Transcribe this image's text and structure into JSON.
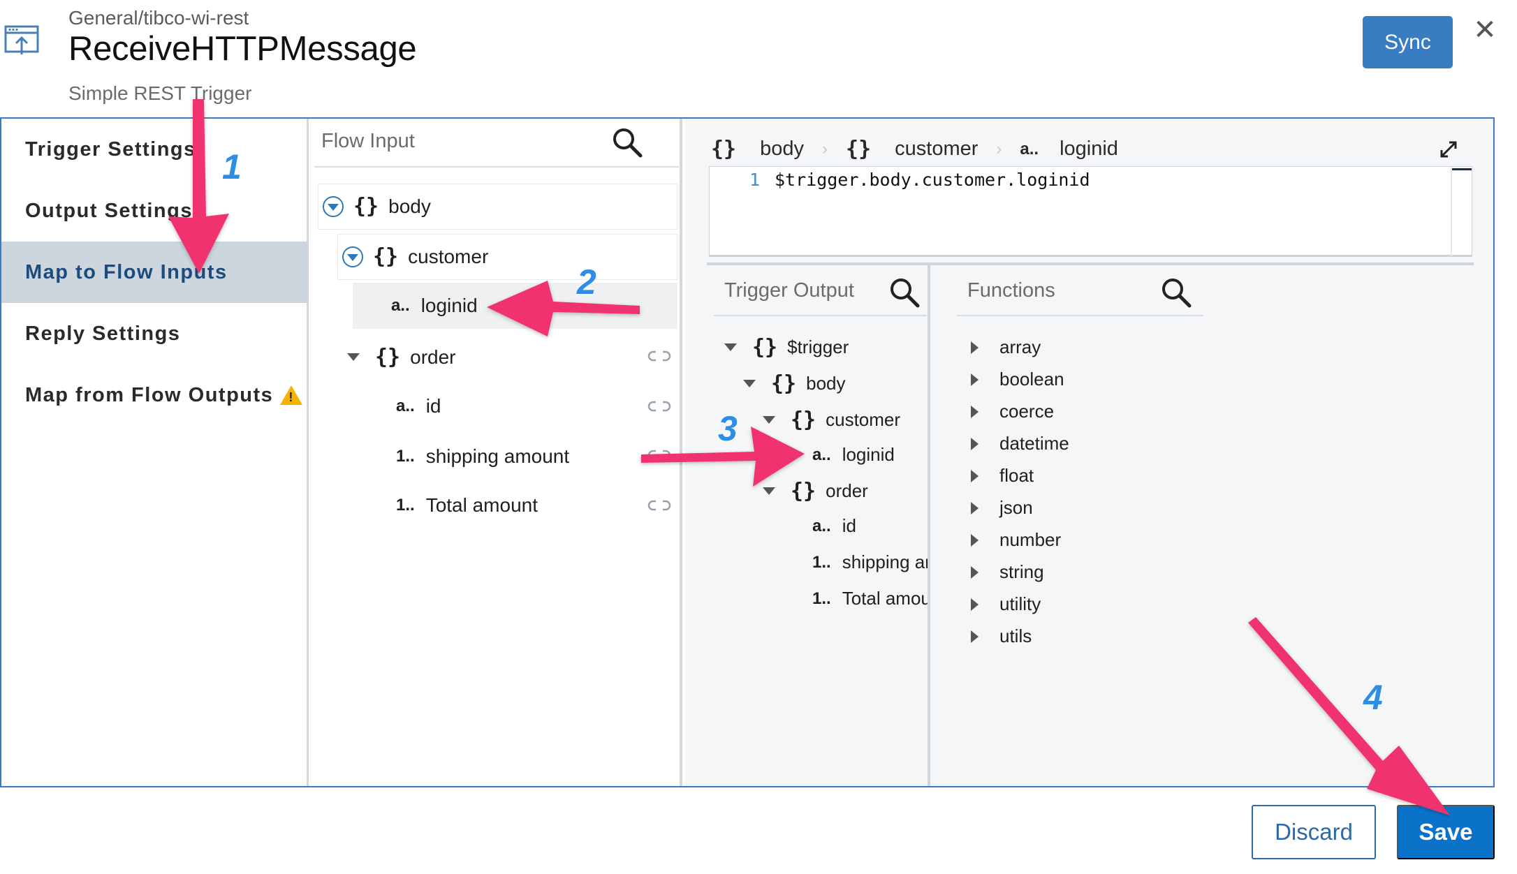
{
  "header": {
    "breadcrumb": "General/tibco-wi-rest",
    "title": "ReceiveHTTPMessage",
    "subtitle": "Simple REST Trigger",
    "sync_label": "Sync",
    "close_glyph": "✕"
  },
  "nav": {
    "items": [
      {
        "label": "Trigger Settings",
        "active": false
      },
      {
        "label": "Output Settings",
        "active": false
      },
      {
        "label": "Map to Flow Inputs",
        "active": true
      },
      {
        "label": "Reply Settings",
        "active": false
      },
      {
        "label": "Map from Flow Outputs",
        "active": false,
        "warning": true
      }
    ],
    "warning_glyph": "!"
  },
  "flow_input": {
    "title": "Flow Input",
    "rows": [
      {
        "type_glyph": "{}",
        "label": "body"
      },
      {
        "type_glyph": "{}",
        "label": "customer"
      },
      {
        "type_glyph": "a..",
        "label": "loginid"
      },
      {
        "type_glyph": "{}",
        "label": "order"
      },
      {
        "type_glyph": "a..",
        "label": "id"
      },
      {
        "type_glyph": "1..",
        "label": "shipping amount"
      },
      {
        "type_glyph": "1..",
        "label": "Total amount"
      }
    ]
  },
  "mapper": {
    "crumbs": [
      {
        "type_glyph": "{}",
        "label": "body"
      },
      {
        "type_glyph": "{}",
        "label": "customer"
      },
      {
        "type_glyph": "a..",
        "label": "loginid"
      }
    ],
    "editor_line_number": "1",
    "editor_expression": "$trigger.body.customer.loginid"
  },
  "trigger_output": {
    "title": "Trigger Output",
    "rows": [
      {
        "type_glyph": "{}",
        "label": "$trigger"
      },
      {
        "type_glyph": "{}",
        "label": "body"
      },
      {
        "type_glyph": "{}",
        "label": "customer"
      },
      {
        "type_glyph": "a..",
        "label": "loginid"
      },
      {
        "type_glyph": "{}",
        "label": "order"
      },
      {
        "type_glyph": "a..",
        "label": "id"
      },
      {
        "type_glyph": "1..",
        "label": "shipping ar"
      },
      {
        "type_glyph": "1..",
        "label": "Total amou"
      }
    ]
  },
  "functions": {
    "title": "Functions",
    "items": [
      "array",
      "boolean",
      "coerce",
      "datetime",
      "float",
      "json",
      "number",
      "string",
      "utility",
      "utils"
    ]
  },
  "annotations": [
    "1",
    "2",
    "3",
    "4"
  ],
  "footer": {
    "discard_label": "Discard",
    "save_label": "Save"
  },
  "colors": {
    "accent": "#3a7cc1",
    "save": "#0a73c9",
    "arrow": "#f0336e",
    "annotation": "#2f8de6",
    "active_nav_bg": "#cdd6df"
  }
}
